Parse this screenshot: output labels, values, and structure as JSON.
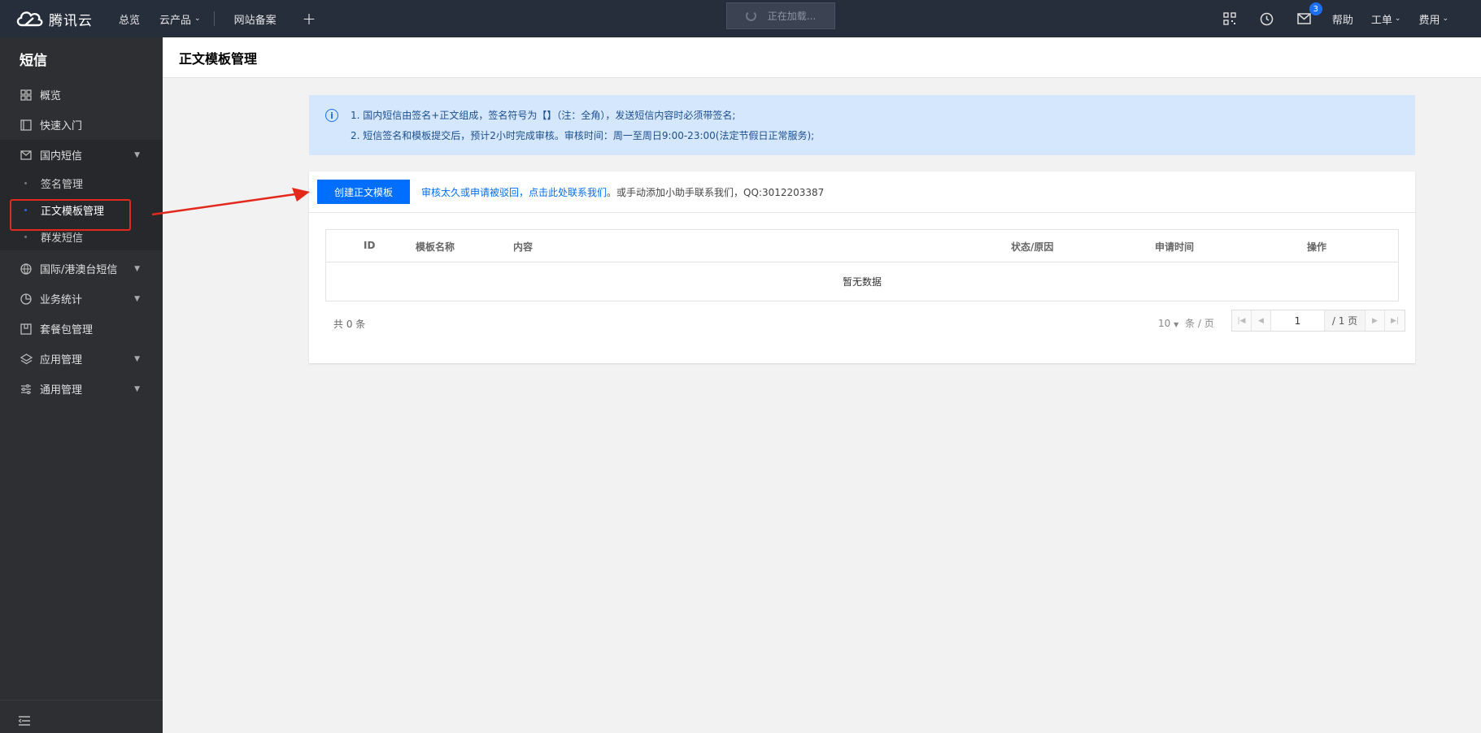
{
  "topbar": {
    "brand": "腾讯云",
    "nav": [
      {
        "label": "总览"
      },
      {
        "label": "云产品",
        "caret": "⌄"
      },
      {
        "label": "网站备案"
      }
    ],
    "plus": "+",
    "loading_text": "正在加载...",
    "mail_badge": "3",
    "right_links": [
      {
        "label": "帮助"
      },
      {
        "label": "工单",
        "caret": "⌄"
      },
      {
        "label": "费用",
        "caret": "⌄"
      }
    ]
  },
  "sidebar": {
    "title": "短信",
    "items": [
      {
        "label": "概览",
        "icon": "grid-icon"
      },
      {
        "label": "快速入门",
        "icon": "book-icon"
      },
      {
        "label": "国内短信",
        "icon": "mail-icon",
        "expanded": true,
        "children": [
          {
            "label": "签名管理"
          },
          {
            "label": "正文模板管理",
            "active": true
          },
          {
            "label": "群发短信"
          }
        ]
      },
      {
        "label": "国际/港澳台短信",
        "icon": "globe-icon"
      },
      {
        "label": "业务统计",
        "icon": "pie-chart-icon"
      },
      {
        "label": "套餐包管理",
        "icon": "package-icon"
      },
      {
        "label": "应用管理",
        "icon": "layers-icon"
      },
      {
        "label": "通用管理",
        "icon": "sliders-icon"
      }
    ]
  },
  "page": {
    "title": "正文模板管理",
    "notice": [
      "1. 国内短信由签名+正文组成，签名符号为【】（注：全角），发送短信内容时必须带签名;",
      "2. 短信签名和模板提交后，预计2小时完成审核。审核时间：周一至周日9:00-23:00(法定节假日正常服务);"
    ],
    "create_button": "创建正文模板",
    "hint_link": "审核太久或申请被驳回，点击此处联系我们",
    "hint_rest": "。或手动添加小助手联系我们，QQ:3012203387",
    "table": {
      "columns": [
        "ID",
        "模板名称",
        "内容",
        "状态/原因",
        "申请时间",
        "操作"
      ],
      "empty_text": "暂无数据"
    },
    "footer": {
      "total": "共 0 条",
      "page_size": "10",
      "page_size_unit": "条 / 页",
      "page_input": "1",
      "page_total": "/ 1 页"
    }
  },
  "colors": {
    "topbar_bg": "#262d3b",
    "sidebar_bg": "#2d2f33",
    "primary": "#006eff",
    "notice_bg": "#d5e7fd",
    "highlight_red": "#e3281c"
  }
}
